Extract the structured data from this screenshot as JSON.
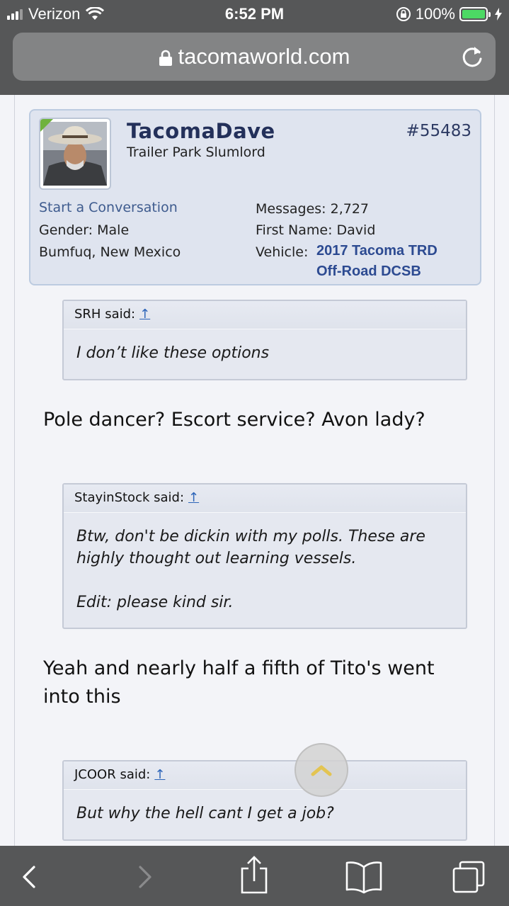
{
  "status_bar": {
    "carrier": "Verizon",
    "time": "6:52 PM",
    "battery": "100%",
    "signal_bars": 3,
    "icons": [
      "signal-icon",
      "wifi-icon",
      "orientation-lock-icon",
      "battery-icon",
      "charging-icon"
    ]
  },
  "browser": {
    "url": "tacomaworld.com",
    "icons": [
      "lock-icon",
      "reload-icon"
    ]
  },
  "post": {
    "username": "TacomaDave",
    "user_title": "Trailer Park Slumlord",
    "post_number": "#55483",
    "start_conversation": "Start a Conversation",
    "gender_label": "Gender:",
    "gender": "Male",
    "location": "Bumfuq, New Mexico",
    "messages_label": "Messages:",
    "messages": "2,727",
    "first_name_label": "First Name:",
    "first_name": "David",
    "vehicle_label": "Vehicle:",
    "vehicle_line1": "2017 Tacoma TRD",
    "vehicle_line2": "Off-Road DCSB"
  },
  "content": {
    "quote1_author": "SRH said:",
    "quote1_text": "I don’t like these options",
    "reply1": "Pole dancer? Escort service? Avon lady?",
    "quote2_author": "StayinStock said:",
    "quote2_text_p1": "Btw, don't be dickin with my polls. These are highly thought out learning vessels.",
    "quote2_text_p2": "Edit: please kind sir.",
    "reply2": "Yeah and nearly half a fifth of Tito's went into this",
    "quote3_author": "JCOOR said:",
    "quote3_text": "But why the hell cant I get a job?",
    "quote_arrow": "↑"
  },
  "toolbar": {
    "icons": [
      "back-icon",
      "forward-icon",
      "share-icon",
      "bookmarks-icon",
      "tabs-icon"
    ]
  },
  "colors": {
    "chrome": "#565758",
    "urlbar": "#838485",
    "username": "#23305a",
    "link": "#2c4a91",
    "header_bg": "#dfe4ef"
  }
}
